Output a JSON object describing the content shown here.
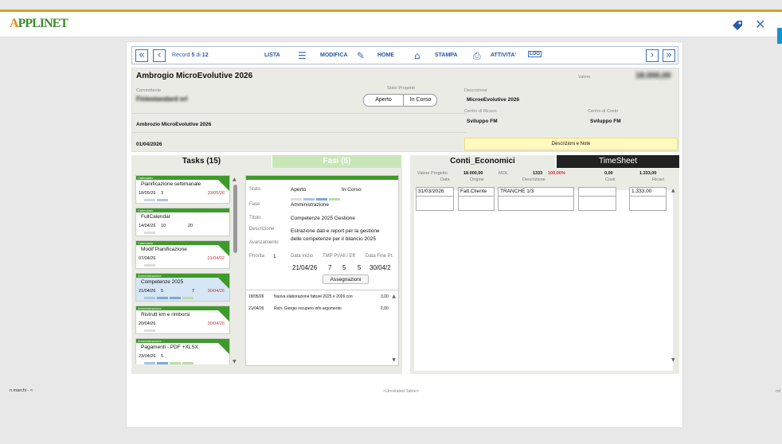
{
  "app": {
    "logo_a": "A",
    "logo_rest": "PPLINET",
    "accent": "#d4a21c",
    "brand_green": "#3e9a2a"
  },
  "topbar": {
    "tag_icon": "tag-icon",
    "close_icon": "close-icon",
    "close_glyph": "✕"
  },
  "nav": {
    "record_label": "Record",
    "record_current": "5",
    "record_of": "di",
    "record_total": "12",
    "lista": "LISTA",
    "modifica": "MODIFICA",
    "home": "HOME",
    "stampa": "STAMPA",
    "attivita": "ATTIVITA'",
    "log": "LOG"
  },
  "header": {
    "title": "Ambrogio MicroEvolutive 2026",
    "valore_label": "Valore",
    "valore_value": "18.000,00",
    "committente_label": "Committente",
    "committente_value": "Finlestandard srl",
    "stato_label": "Stato Progetto",
    "stato_left": "Aperto",
    "stato_right": "In Corso",
    "descrizione_label": "Descrizione",
    "descrizione_value": "MicroeEvolutive 2026",
    "centro_ricavo_label": "Centro di Ricavo",
    "centro_ricavo_value": "Sviluppo FM",
    "centro_costo_label": "Centro di Costo",
    "centro_costo_value": "Sviluppo FM",
    "project_name": "Ambrozio MicroEvolutive 2026",
    "date": "01/04/2026",
    "note_button": "Descrizioni e Note"
  },
  "tabs": {
    "tasks": "Tasks (15)",
    "fasi": "Fasi (5)",
    "conti": "Conti_Economici",
    "timesheet": "TimeSheet"
  },
  "tasks": [
    {
      "cat": "Calendario",
      "name": "Pianificazione settimanale",
      "date": "18/05/26",
      "n1": "3",
      "n2": "",
      "deadline": "23/05/26"
    },
    {
      "cat": "Calendario",
      "name": "FullCalendar",
      "date": "14/04/26",
      "n1": "10",
      "n2": "20",
      "deadline": ""
    },
    {
      "cat": "Calendario",
      "name": "Modif Pianificazione",
      "date": "07/04/26",
      "n1": "",
      "n2": "",
      "deadline": "01/04/02"
    },
    {
      "cat": "Amministrazione",
      "name": "Competenze 2025",
      "date": "21/04/26",
      "n1": "5",
      "n2": "7",
      "deadline": "30/04/26"
    },
    {
      "cat": "Amministrazione",
      "name": "Ristrutt km e rimborsi",
      "date": "20/04/26",
      "n1": "",
      "n2": "",
      "deadline": "30/04/26"
    },
    {
      "cat": "Amministrazione",
      "name": "Pagamenti - PDF +XLSX",
      "date": "23/04/26",
      "n1": "5",
      "n2": "",
      "deadline": ""
    }
  ],
  "fase": {
    "stato_label": "Stato",
    "stato_a": "Aperto",
    "stato_b": "In Corso",
    "fase_label": "Fase",
    "fase_value": "Amministrazione",
    "titolo_label": "Titolo",
    "titolo_value": "Competenze 2025 Gestione",
    "descr_label": "Descrizione",
    "descr_value1": "Estrazione dati e report per la gestione",
    "descr_value2": "delle competenze per il bilancio 2025",
    "avanz_label": "Avanzamento",
    "prio_label": "Priorita",
    "prio_value": "1",
    "h_inizio": "Data inizio",
    "h_tmp": "TMP Pr/All / Eff",
    "h_fine": "Data Fine Pr.",
    "v_inizio": "21/04/26",
    "v_t1": "7",
    "v_t2": "5",
    "v_t3": "5",
    "v_fine": "30/04/2",
    "assegnazioni": "Assegnazioni"
  },
  "activities": [
    {
      "date": "18/05/26",
      "text": "Nuova elaborazione fatture 2025 e 2026 con",
      "value": "3,00"
    },
    {
      "date": "21/04/26",
      "text": "Rich. Giorgio recupero info argomento",
      "value": "2,00"
    }
  ],
  "conti": {
    "h_valore": "Valore Progetto",
    "v_valore": "18.000,00",
    "h_mol": "MOL",
    "v_mol": "1333",
    "v_mol_pct": "100,00%",
    "v_costi": "0,00",
    "v_ricavi": "1.333,00",
    "h_data": "Data",
    "h_origine": "Origine",
    "h_descr": "Descrizione",
    "h_costi": "Costi",
    "h_ricavi": "Ricavi",
    "row_data": "31/03/2026",
    "row_origine": "Fatt.Cliente",
    "row_descr": "TRANCHE 1/3",
    "row_costi": "",
    "row_ricavi": "1.333,00"
  },
  "footer": {
    "user": "n.marchi - <",
    "unrelated": "<Unrelated Table>",
    "right_edge": "rel"
  }
}
